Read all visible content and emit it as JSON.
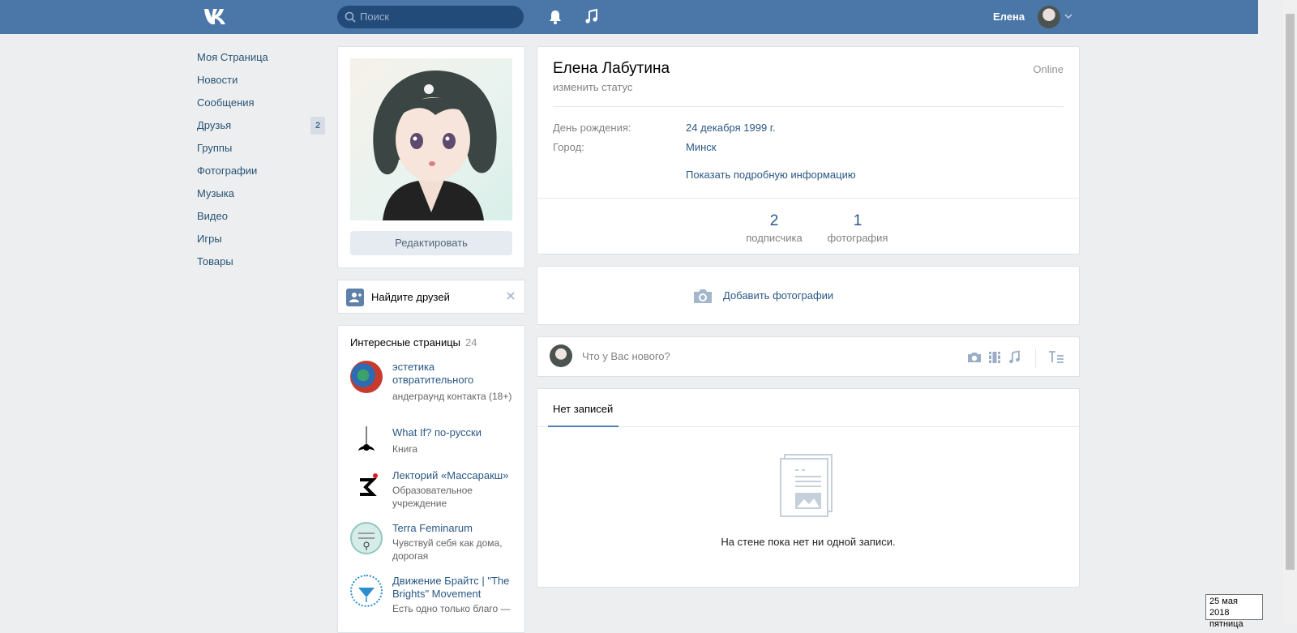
{
  "header": {
    "search_placeholder": "Поиск",
    "user_name": "Елена"
  },
  "nav": {
    "items": [
      {
        "label": "Моя Страница"
      },
      {
        "label": "Новости"
      },
      {
        "label": "Сообщения"
      },
      {
        "label": "Друзья",
        "badge": "2"
      },
      {
        "label": "Группы"
      },
      {
        "label": "Фотографии"
      },
      {
        "label": "Музыка"
      },
      {
        "label": "Видео"
      },
      {
        "label": "Игры"
      },
      {
        "label": "Товары"
      }
    ]
  },
  "avatar_card": {
    "edit_label": "Редактировать"
  },
  "find_friends": {
    "label": "Найдите друзей"
  },
  "interesting_pages": {
    "title": "Интересные страницы",
    "count": "24",
    "items": [
      {
        "name": "эстетика отвратительного",
        "subtitle": "андеграунд контакта (18+)"
      },
      {
        "name": "What If? по-русски",
        "subtitle": "Книга"
      },
      {
        "name": "Лекторий «Массаракш»",
        "subtitle": "Образовательное учреждение"
      },
      {
        "name": "Terra Feminarum",
        "subtitle": "Чувствуй себя как дома, дорогая"
      },
      {
        "name": "Движение Брайтс | \"The Brights\" Movement",
        "subtitle": "Есть одно только благо —"
      }
    ]
  },
  "profile": {
    "name": "Елена Лабутина",
    "status": "изменить статус",
    "online": "Online",
    "birthday_label": "День рождения:",
    "birthday_value": "24 декабря 1999 г.",
    "city_label": "Город:",
    "city_value": "Минск",
    "more_info": "Показать подробную информацию",
    "counters": [
      {
        "number": "2",
        "label": "подписчика"
      },
      {
        "number": "1",
        "label": "фотография"
      }
    ]
  },
  "photos": {
    "add_label": "Добавить фотографии"
  },
  "post": {
    "placeholder": "Что у Вас нового?"
  },
  "wall": {
    "tab_label": "Нет записей",
    "empty_text": "На стене пока нет ни одной записи."
  },
  "tooltip": {
    "date": "25 мая 2018",
    "weekday": "пятница"
  },
  "colors": {
    "header": "#4a76a8",
    "link": "#2a5885",
    "background": "#edeef0"
  }
}
